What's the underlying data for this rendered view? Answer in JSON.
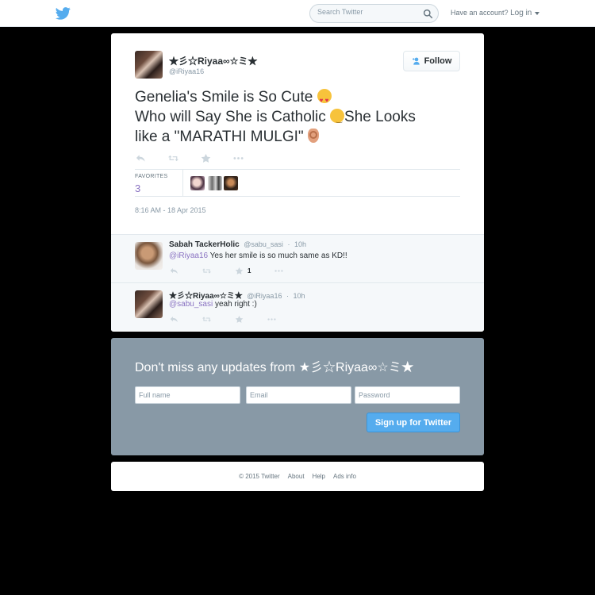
{
  "topbar": {
    "search_placeholder": "Search Twitter",
    "account_prompt": "Have an account?",
    "login_label": "Log in"
  },
  "tweet": {
    "author_name": "★彡☆Riyaa∞☆ミ★",
    "author_handle": "@iRiyaa16",
    "follow_label": "Follow",
    "text_line1": "Genelia's Smile is So Cute",
    "text_line2a": "Who will Say She is Catholic",
    "text_line2b": "She Looks",
    "text_line3": "like a \"MARATHI MULGI\"",
    "favorites_label": "FAVORITES",
    "favorites_count": "3",
    "timestamp": "8:16 AM - 18 Apr 2015"
  },
  "replies": [
    {
      "name": "Sabah TackerHolic",
      "handle": "@sabu_sasi",
      "time": "10h",
      "mention": "@iRiyaa16",
      "text": " Yes her smile is so much same as KD!!",
      "favorite_count": "1"
    },
    {
      "name": "★彡☆Riyaa∞☆ミ★",
      "handle": "@iRiyaa16",
      "time": "10h",
      "mention": "@sabu_sasi",
      "text": " yeah right :)"
    }
  ],
  "signup": {
    "heading": "Don't miss any updates from ★彡☆Riyaa∞☆ミ★",
    "fullname_placeholder": "Full name",
    "email_placeholder": "Email",
    "password_placeholder": "Password",
    "button_label": "Sign up for Twitter"
  },
  "footer": {
    "copyright": "© 2015 Twitter",
    "about": "About",
    "help": "Help",
    "ads": "Ads info"
  },
  "colors": {
    "brand_blue": "#55acee",
    "mention_purple": "#8a73c2",
    "signup_bg": "#8899a6"
  }
}
